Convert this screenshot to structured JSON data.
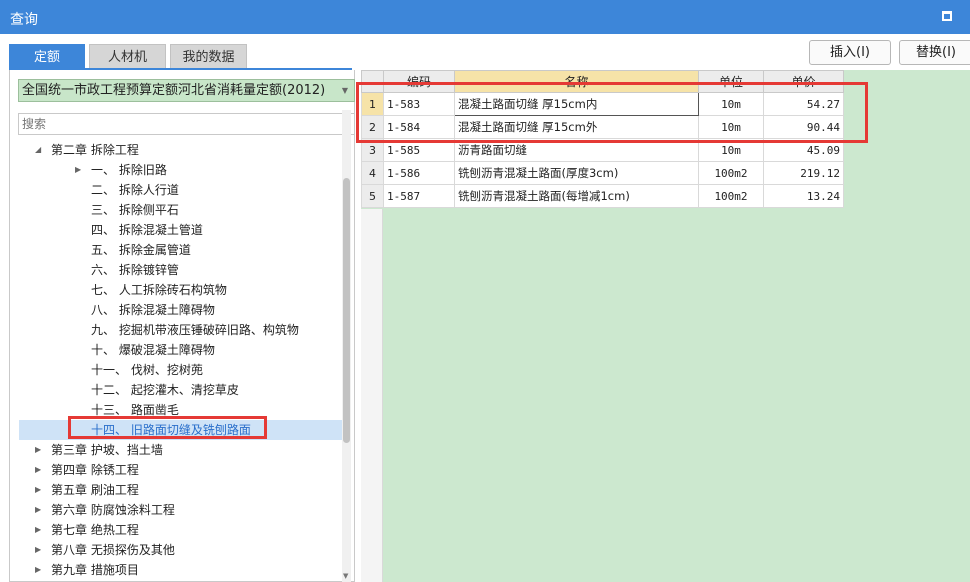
{
  "window": {
    "title": "查询"
  },
  "tabs": [
    {
      "label": "定额",
      "active": true
    },
    {
      "label": "人材机",
      "active": false
    },
    {
      "label": "我的数据",
      "active": false
    }
  ],
  "toolbar": {
    "insert_label": "插入(I)",
    "replace_label": "替换(I)"
  },
  "library_select": {
    "value": "全国统一市政工程预算定额河北省消耗量定额(2012)"
  },
  "search": {
    "placeholder": "搜索"
  },
  "tree": [
    {
      "label": "第二章 拆除工程",
      "level": 0,
      "expander": "expanded"
    },
    {
      "label": "一、 拆除旧路",
      "level": 1,
      "expander": "collapsed"
    },
    {
      "label": "二、 拆除人行道",
      "level": 1,
      "expander": "none"
    },
    {
      "label": "三、 拆除侧平石",
      "level": 1,
      "expander": "none"
    },
    {
      "label": "四、 拆除混凝土管道",
      "level": 1,
      "expander": "none"
    },
    {
      "label": "五、 拆除金属管道",
      "level": 1,
      "expander": "none"
    },
    {
      "label": "六、 拆除镀锌管",
      "level": 1,
      "expander": "none"
    },
    {
      "label": "七、 人工拆除砖石构筑物",
      "level": 1,
      "expander": "none"
    },
    {
      "label": "八、 拆除混凝土障碍物",
      "level": 1,
      "expander": "none"
    },
    {
      "label": "九、 挖掘机带液压锤破碎旧路、构筑物",
      "level": 1,
      "expander": "none"
    },
    {
      "label": "十、 爆破混凝土障碍物",
      "level": 1,
      "expander": "none"
    },
    {
      "label": "十一、 伐树、挖树蔸",
      "level": 1,
      "expander": "none"
    },
    {
      "label": "十二、 起挖灌木、清挖草皮",
      "level": 1,
      "expander": "none"
    },
    {
      "label": "十三、 路面凿毛",
      "level": 1,
      "expander": "none"
    },
    {
      "label": "十四、 旧路面切缝及铣刨路面",
      "level": 1,
      "expander": "none",
      "selected": true
    },
    {
      "label": "第三章 护坡、挡土墙",
      "level": 0,
      "expander": "collapsed"
    },
    {
      "label": "第四章 除锈工程",
      "level": 0,
      "expander": "collapsed"
    },
    {
      "label": "第五章 刷油工程",
      "level": 0,
      "expander": "collapsed"
    },
    {
      "label": "第六章 防腐蚀涂料工程",
      "level": 0,
      "expander": "collapsed"
    },
    {
      "label": "第七章 绝热工程",
      "level": 0,
      "expander": "collapsed"
    },
    {
      "label": "第八章 无损探伤及其他",
      "level": 0,
      "expander": "collapsed"
    },
    {
      "label": "第九章 措施项目",
      "level": 0,
      "expander": "collapsed"
    }
  ],
  "grid": {
    "headers": {
      "code": "编码",
      "name": "名称",
      "unit": "单位",
      "price": "单价"
    },
    "rows": [
      {
        "no": "1",
        "code": "1-583",
        "name": "混凝土路面切缝 厚15cm内",
        "unit": "10m",
        "price": "54.27",
        "current": true
      },
      {
        "no": "2",
        "code": "1-584",
        "name": "混凝土路面切缝 厚15cm外",
        "unit": "10m",
        "price": "90.44"
      },
      {
        "no": "3",
        "code": "1-585",
        "name": "沥青路面切缝",
        "unit": "10m",
        "price": "45.09"
      },
      {
        "no": "4",
        "code": "1-586",
        "name": "铣刨沥青混凝土路面(厚度3cm)",
        "unit": "100m2",
        "price": "219.12"
      },
      {
        "no": "5",
        "code": "1-587",
        "name": "铣刨沥青混凝土路面(每增减1cm)",
        "unit": "100m2",
        "price": "13.24"
      }
    ]
  },
  "colors": {
    "accent": "#3d86d9",
    "grid_background": "#cce8cf",
    "highlight_box": "#e53935"
  }
}
